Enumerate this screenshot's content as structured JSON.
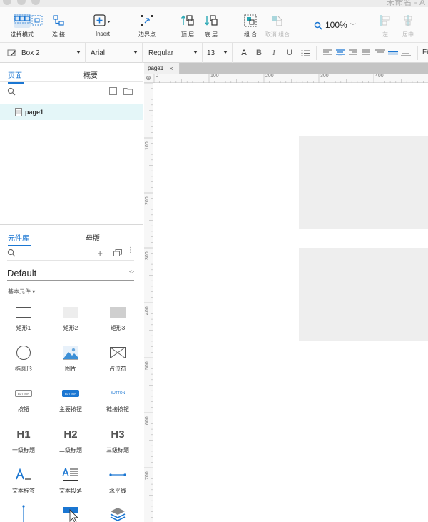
{
  "window": {
    "title": "未命名 - A"
  },
  "toolbar": {
    "select_mode": "选择模式",
    "connect": "连 接",
    "insert": "Insert",
    "boundary_points": "边界点",
    "bring_to_front": "顶 层",
    "send_to_back": "底 层",
    "group": "组 合",
    "ungroup": "取消 组合",
    "zoom": "100%",
    "align_left": "左",
    "align_center": "居中"
  },
  "format": {
    "element_name": "Box 2",
    "font_family": "Arial",
    "font_weight": "Regular",
    "font_size": "13",
    "more": "Fi"
  },
  "left_panel": {
    "tab_pages": "页面",
    "tab_outline": "概要",
    "pages": [
      {
        "name": "page1"
      }
    ],
    "tab_library": "元件库",
    "tab_masters": "母版",
    "library_name": "Default",
    "section_label": "基本元件 ▾",
    "widgets": [
      {
        "label": "矩形1",
        "icon": "rectangle-outline-icon"
      },
      {
        "label": "矩形2",
        "icon": "rectangle-light-icon"
      },
      {
        "label": "矩形3",
        "icon": "rectangle-gray-icon"
      },
      {
        "label": "椭圆形",
        "icon": "ellipse-icon"
      },
      {
        "label": "图片",
        "icon": "image-icon"
      },
      {
        "label": "占位符",
        "icon": "placeholder-icon"
      },
      {
        "label": "按钮",
        "icon": "button-icon",
        "text": "BUTTON"
      },
      {
        "label": "主要按钮",
        "icon": "primary-button-icon",
        "text": "BUTTON"
      },
      {
        "label": "链接按钮",
        "icon": "link-button-icon",
        "text": "BUTTON"
      },
      {
        "label": "一级标题",
        "icon": "h1-icon",
        "text": "H1"
      },
      {
        "label": "二级标题",
        "icon": "h2-icon",
        "text": "H2"
      },
      {
        "label": "三级标题",
        "icon": "h3-icon",
        "text": "H3"
      },
      {
        "label": "文本标签",
        "icon": "text-label-icon"
      },
      {
        "label": "文本段落",
        "icon": "text-paragraph-icon"
      },
      {
        "label": "水平线",
        "icon": "horizontal-line-icon"
      },
      {
        "label": "",
        "icon": "vertical-line-icon"
      },
      {
        "label": "",
        "icon": "hotspot-icon"
      },
      {
        "label": "",
        "icon": "dynamic-panel-icon"
      }
    ]
  },
  "canvas": {
    "tab_name": "page1",
    "tab_close": "×",
    "h_ruler_labels": [
      "0",
      "100",
      "200",
      "300",
      "400"
    ],
    "v_ruler_labels": [
      "100",
      "200",
      "300",
      "400",
      "500",
      "600",
      "700"
    ],
    "corner_symbol": "⊕"
  },
  "colors": {
    "accent": "#1a76d2",
    "teal": "#28a7b4",
    "selection_row": "#e4f6f8",
    "shape_fill": "#eeeeee"
  }
}
